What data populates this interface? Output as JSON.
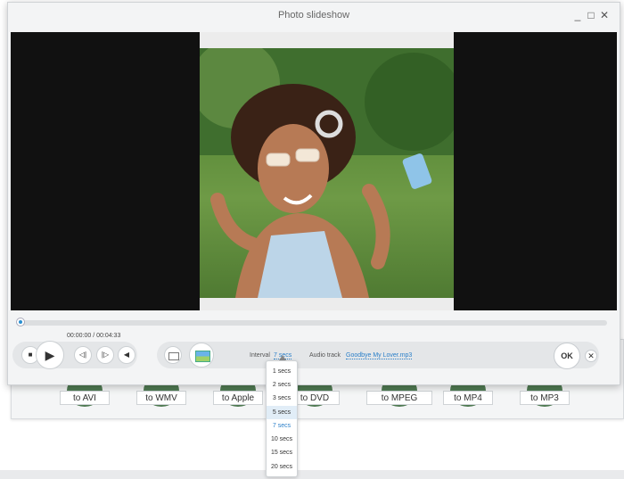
{
  "window": {
    "title": "Photo slideshow"
  },
  "player": {
    "timecode": "00:00:00 / 00:04:33"
  },
  "controls": {
    "play_icon": "play-icon",
    "stop_icon": "stop-icon",
    "prev_icon": "prev-frame-icon",
    "next_icon": "next-frame-icon",
    "volume_icon": "volume-icon",
    "stop_glyph": "■",
    "play_glyph": "▶",
    "prev_glyph": "◁|",
    "next_glyph": "|▷",
    "volume_glyph": "◀"
  },
  "settings": {
    "interval_label": "Interval",
    "interval_value": "7 secs",
    "audio_label": "Audio track",
    "audio_value": "Goodbye My Lover.mp3"
  },
  "actions": {
    "ok_label": "OK",
    "close_glyph": "✕"
  },
  "titlebar_buttons": {
    "minimize": "_",
    "maximize": "□",
    "close": "✕"
  },
  "interval_options": [
    "1 secs",
    "2 secs",
    "3 secs",
    "5 secs",
    "7 secs",
    "10 secs",
    "15 secs",
    "20 secs"
  ],
  "interval_highlighted": "5 secs",
  "converter": [
    "to AVI",
    "to WMV",
    "to Apple",
    "to DVD",
    "to MPEG",
    "to MP4",
    "to MP3"
  ],
  "colors": {
    "accent": "#2a7fc9",
    "video_bg": "#111111",
    "window_bg": "#f3f4f5"
  }
}
